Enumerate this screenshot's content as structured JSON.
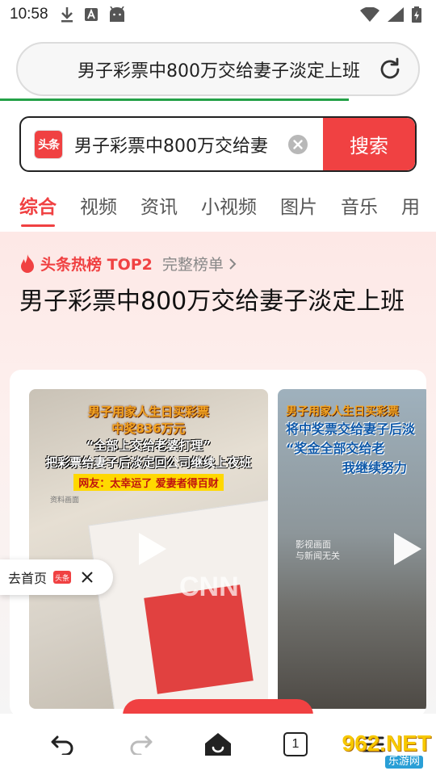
{
  "status_bar": {
    "time": "10:58"
  },
  "url_bar": {
    "text": "男子彩票中800万交给妻子淡定上班"
  },
  "search": {
    "logo_text": "头条",
    "query": "男子彩票中800万交给妻",
    "button_label": "搜索"
  },
  "tabs": [
    {
      "label": "综合",
      "active": true
    },
    {
      "label": "视频",
      "active": false
    },
    {
      "label": "资讯",
      "active": false
    },
    {
      "label": "小视频",
      "active": false
    },
    {
      "label": "图片",
      "active": false
    },
    {
      "label": "音乐",
      "active": false
    },
    {
      "label": "用",
      "active": false
    }
  ],
  "hot": {
    "rank_label": "头条热榜 TOP2",
    "full_list_label": "完整榜单",
    "title": "男子彩票中800万交给妻子淡定上班"
  },
  "videos": [
    {
      "lines": [
        "男子用家人生日买彩票",
        "中奖836万元",
        "“全部上交给老婆打理”",
        "把彩票给妻子后淡定回公司继续上夜班"
      ],
      "tag": "网友：太幸运了 爱妻者得百财",
      "note": "资料画面",
      "watermark": "CNN"
    },
    {
      "lines": [
        "男子用家人生日买彩票",
        "将中奖票交给妻子后淡",
        "“奖金全部交给老",
        "我继续努力"
      ],
      "note_lines": [
        "影视画面",
        "与新闻无关"
      ]
    }
  ],
  "go_home": {
    "label": "去首页",
    "logo_text": "头条"
  },
  "bottom_bar": {
    "tab_count": "1"
  },
  "watermark": {
    "number": "962.NET",
    "sub": "乐游网"
  },
  "colors": {
    "accent": "#f04142",
    "progress": "#24a148"
  }
}
